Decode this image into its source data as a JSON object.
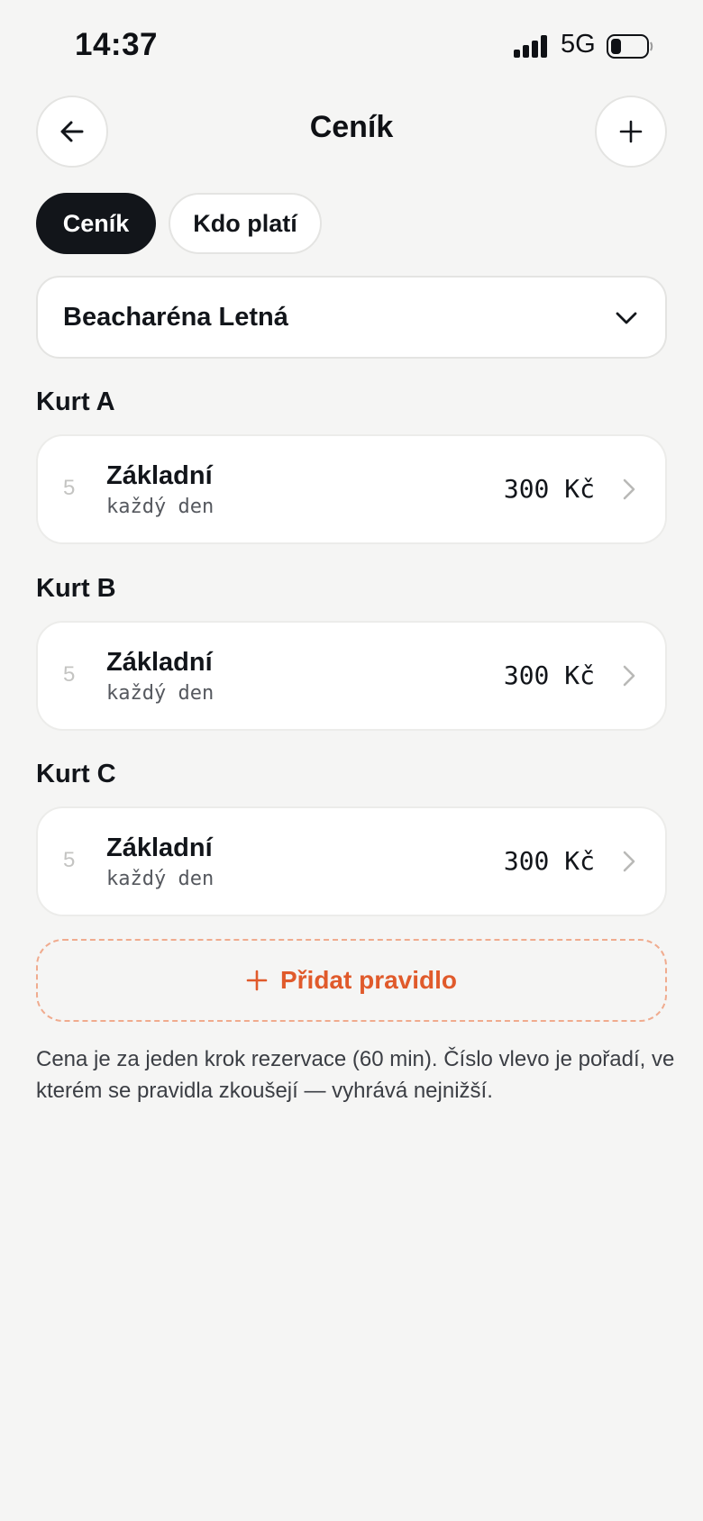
{
  "status_bar": {
    "time": "14:37",
    "network": "5G",
    "icons": [
      "signal-icon",
      "battery-icon"
    ]
  },
  "header": {
    "title": "Ceník",
    "back_icon": "arrow-left-icon",
    "add_icon": "plus-icon"
  },
  "tabs": [
    {
      "label": "Ceník",
      "active": true
    },
    {
      "label": "Kdo platí",
      "active": false
    }
  ],
  "venue_select": {
    "value": "Beacharéna Letná",
    "icon": "chevron-down-icon"
  },
  "courts": [
    {
      "name": "Kurt A",
      "rules": [
        {
          "priority": "5",
          "name": "Základní",
          "days": "každý den",
          "price": "300 Kč"
        }
      ]
    },
    {
      "name": "Kurt B",
      "rules": [
        {
          "priority": "5",
          "name": "Základní",
          "days": "každý den",
          "price": "300 Kč"
        }
      ]
    },
    {
      "name": "Kurt C",
      "rules": [
        {
          "priority": "5",
          "name": "Základní",
          "days": "každý den",
          "price": "300 Kč"
        }
      ]
    }
  ],
  "add_rule": {
    "label": "Přidat pravidlo",
    "icon": "plus-icon"
  },
  "footnote": "Cena je za jeden krok rezervace (60 min). Číslo vlevo je pořadí, ve kterém se pravidla zkoušejí — vyhrává nejnižší.",
  "colors": {
    "background": "#f5f5f4",
    "accent": "#e05a2b",
    "accent_dashed_border": "#f0ab8e",
    "active_tab": "#12151a",
    "card": "#ffffff"
  }
}
